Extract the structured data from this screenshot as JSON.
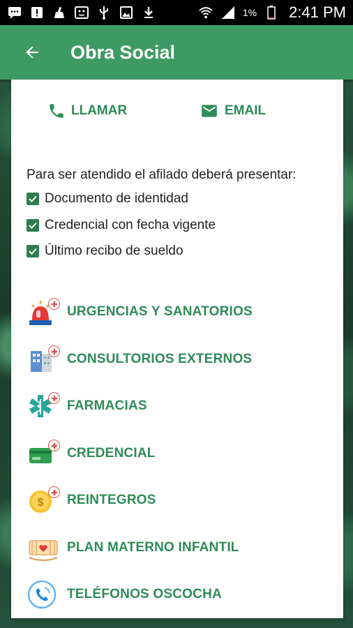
{
  "status_bar": {
    "battery_percent": "1%",
    "time": "2:41 PM",
    "icons": [
      "message-icon",
      "alert-icon",
      "cleaner-icon",
      "face-icon",
      "usb-icon",
      "image-icon",
      "download-icon",
      "wifi-icon",
      "signal-icon",
      "battery-icon"
    ]
  },
  "app_bar": {
    "title": "Obra Social",
    "back_icon": "arrow-back-icon"
  },
  "contact": {
    "call_label": "LLAMAR",
    "email_label": "EMAIL"
  },
  "requirements": {
    "title": "Para ser atendido el afilado deberá presentar:",
    "items": [
      {
        "label": "Documento de identidad",
        "checked": true
      },
      {
        "label": "Credencial con fecha vigente",
        "checked": true
      },
      {
        "label": "Último recibo de sueldo",
        "checked": true
      }
    ]
  },
  "menu": [
    {
      "label": "URGENCIAS Y SANATORIOS",
      "icon": "siren-icon"
    },
    {
      "label": "CONSULTORIOS EXTERNOS",
      "icon": "building-icon"
    },
    {
      "label": "FARMACIAS",
      "icon": "pharmacy-icon"
    },
    {
      "label": "CREDENCIAL",
      "icon": "card-icon"
    },
    {
      "label": "REINTEGROS",
      "icon": "coin-icon"
    },
    {
      "label": "PLAN MATERNO INFANTIL",
      "icon": "cradle-icon"
    },
    {
      "label": "TELÉFONOS OSCOCHA",
      "icon": "phone-circle-icon"
    }
  ],
  "colors": {
    "app_bar": "#3d9a63",
    "accent": "#2e8b57",
    "checkbox": "#2e7d4f",
    "badge": "#d9534f"
  }
}
